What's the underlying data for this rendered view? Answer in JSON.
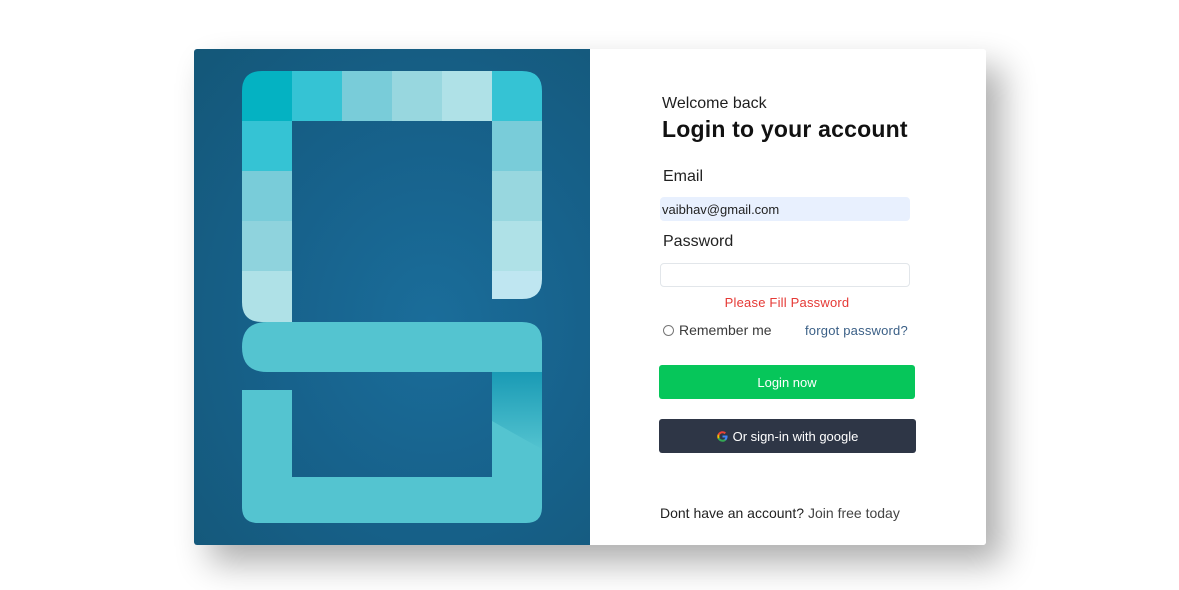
{
  "form": {
    "welcome": "Welcome back",
    "title": "Login to your account",
    "email_label": "Email",
    "email_value": "vaibhav@gmail.com",
    "password_label": "Password",
    "password_value": "",
    "error": "Please Fill Password",
    "remember_label": "Remember me",
    "forgot_label": "forgot password?",
    "login_button": "Login now",
    "google_button": "Or sign-in with google",
    "signup_prompt": "Dont have an account?",
    "signup_link": "Join free today"
  },
  "icons": {
    "brand": "logo-icon",
    "google": "google-icon"
  },
  "colors": {
    "login_button": "#06c65a",
    "google_button": "#2e3646",
    "error": "#e53935",
    "art_background": "#17628c"
  }
}
